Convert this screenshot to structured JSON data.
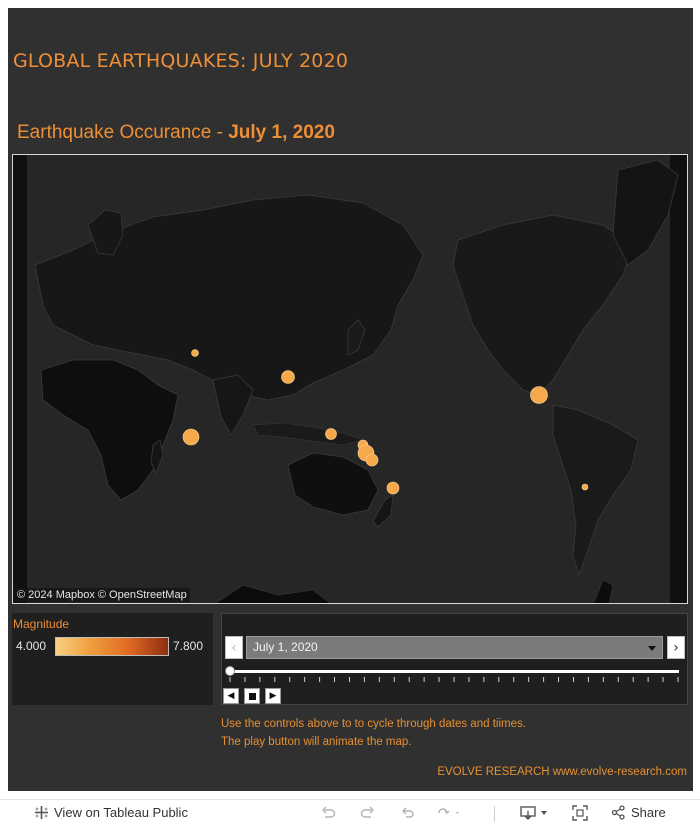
{
  "header": {
    "title": "GLOBAL EARTHQUAKES: JULY 2020",
    "subtitle_prefix": "Earthquake Occurance - ",
    "subtitle_date": "July 1, 2020"
  },
  "map": {
    "attribution": "© 2024 Mapbox  © OpenStreetMap",
    "marker_color": "#f6a94a",
    "quake_count": 10
  },
  "legend": {
    "title": "Magnitude",
    "min_label": "4.000",
    "max_label": "7.800",
    "gradient_colors": [
      "#fad080",
      "#f0a040",
      "#e06a22",
      "#8f2d12"
    ]
  },
  "player": {
    "selected_date": "July 1, 2020",
    "prev_icon": "chevron-left-icon",
    "next_icon": "chevron-right-icon",
    "slider_position": 0
  },
  "help": {
    "line1": "Use the controls above to to cycle through dates and tiimes.",
    "line2": "The play button will animate the map."
  },
  "credit": "EVOLVE RESEARCH www.evolve-research.com",
  "toolbar": {
    "view_label": "View on Tableau Public",
    "share_label": "Share"
  },
  "colors": {
    "accent": "#ef8f35",
    "background": "#303030",
    "panel": "#1f1f1f"
  }
}
